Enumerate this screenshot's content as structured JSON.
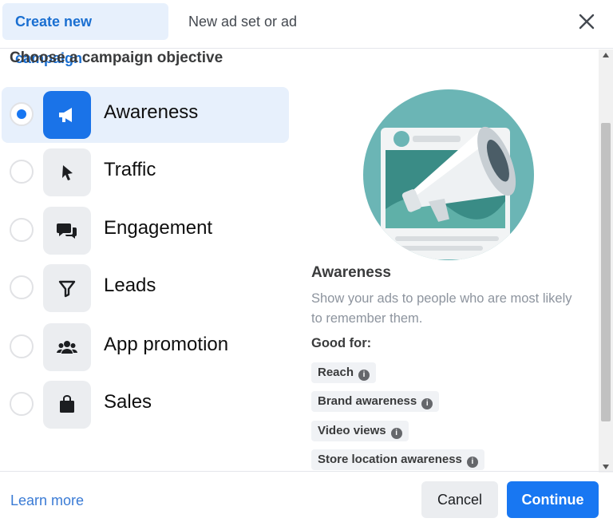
{
  "header": {
    "tabs": [
      {
        "label": "Create new campaign",
        "active": true
      },
      {
        "label": "New ad set or ad",
        "active": false
      }
    ],
    "close_icon": "close-icon"
  },
  "section_title": "Choose a campaign objective",
  "objectives": [
    {
      "label": "Awareness",
      "icon": "megaphone-icon",
      "selected": true
    },
    {
      "label": "Traffic",
      "icon": "cursor-icon",
      "selected": false
    },
    {
      "label": "Engagement",
      "icon": "chat-bubbles-icon",
      "selected": false
    },
    {
      "label": "Leads",
      "icon": "funnel-icon",
      "selected": false
    },
    {
      "label": "App promotion",
      "icon": "people-icon",
      "selected": false
    },
    {
      "label": "Sales",
      "icon": "shopping-bag-icon",
      "selected": false
    }
  ],
  "detail": {
    "title": "Awareness",
    "description": "Show your ads to people who are most likely to remember them.",
    "good_for_label": "Good for:",
    "good_for": [
      "Reach",
      "Brand awareness",
      "Video views",
      "Store location awareness"
    ]
  },
  "footer": {
    "learn_more": "Learn more",
    "cancel": "Cancel",
    "continue": "Continue"
  },
  "colors": {
    "accent": "#1877f2",
    "selected_bg": "#e7f0fc",
    "illustration_circle": "#6bb5b5"
  }
}
